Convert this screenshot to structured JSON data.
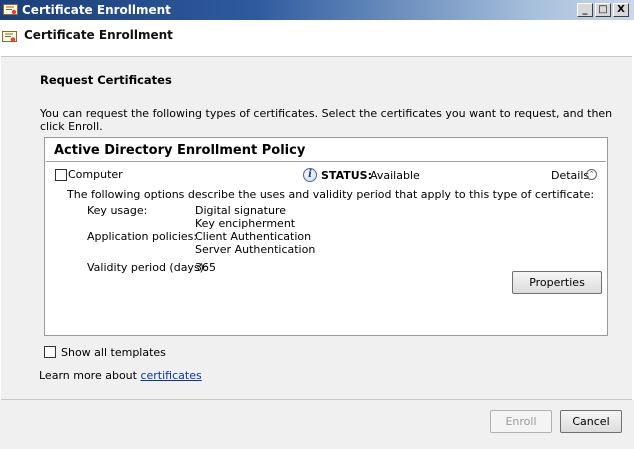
{
  "window": {
    "title": "Certificate Enrollment",
    "controls": {
      "minimize": "_",
      "maximize": "□",
      "close": "X"
    }
  },
  "header": {
    "title": "Certificate Enrollment"
  },
  "page": {
    "section_title": "Request Certificates",
    "intro": "You can request the following types of certificates. Select the certificates you want to request, and then click Enroll."
  },
  "policy": {
    "title": "Active Directory Enrollment Policy",
    "certificate": {
      "name": "Computer",
      "checked": false,
      "status_label": "STATUS:",
      "status_value": "Available",
      "details_label": "Details",
      "description": "The following options describe the uses and validity period that apply to this type of certificate:",
      "key_usage_label": "Key usage:",
      "key_usage_values": [
        "Digital signature",
        "Key encipherment"
      ],
      "app_policies_label": "Application policies:",
      "app_policies_values": [
        "Client Authentication",
        "Server Authentication"
      ],
      "validity_label": "Validity period (days):",
      "validity_value": "365",
      "properties_label": "Properties"
    }
  },
  "options": {
    "show_all_templates": "Show all templates",
    "show_all_checked": false
  },
  "learn_more": {
    "prefix": "Learn more about ",
    "link": "certificates"
  },
  "buttons": {
    "enroll": "Enroll",
    "cancel": "Cancel"
  },
  "icons": {
    "app": "certificate-icon",
    "header": "certificate-icon",
    "status": "info-icon",
    "details": "chevron-up-circle-icon"
  },
  "colors": {
    "title_bar": "#2e5a9e",
    "link": "#0b33a8",
    "panel": "#f0f0f0"
  }
}
